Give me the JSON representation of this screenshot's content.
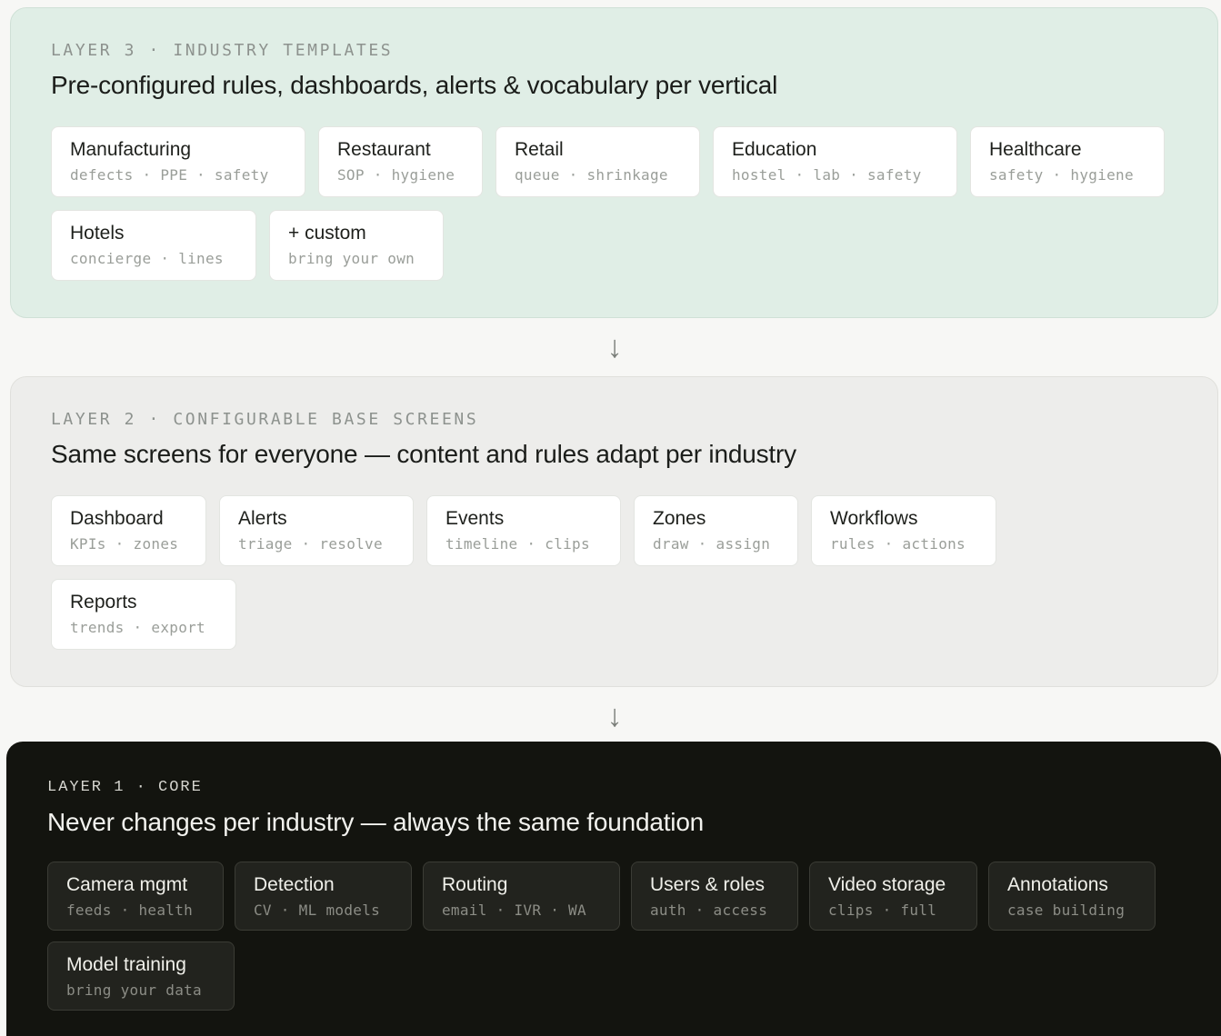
{
  "layer3": {
    "eyebrow": "LAYER 3 · INDUSTRY TEMPLATES",
    "title": "Pre-configured rules, dashboards, alerts & vocabulary per vertical",
    "chips": [
      {
        "title": "Manufacturing",
        "sub": "defects · PPE · safety"
      },
      {
        "title": "Restaurant",
        "sub": "SOP · hygiene"
      },
      {
        "title": "Retail",
        "sub": "queue · shrinkage"
      },
      {
        "title": "Education",
        "sub": "hostel · lab · safety"
      },
      {
        "title": "Healthcare",
        "sub": "safety · hygiene"
      },
      {
        "title": "Hotels",
        "sub": "concierge · lines"
      },
      {
        "title": "+ custom",
        "sub": "bring your own"
      }
    ]
  },
  "arrow": "↓",
  "layer2": {
    "eyebrow": "LAYER 2 · CONFIGURABLE BASE SCREENS",
    "title": "Same screens for everyone — content and rules adapt per industry",
    "chips": [
      {
        "title": "Dashboard",
        "sub": "KPIs · zones"
      },
      {
        "title": "Alerts",
        "sub": "triage · resolve"
      },
      {
        "title": "Events",
        "sub": "timeline · clips"
      },
      {
        "title": "Zones",
        "sub": "draw · assign"
      },
      {
        "title": "Workflows",
        "sub": "rules · actions"
      },
      {
        "title": "Reports",
        "sub": "trends · export"
      }
    ]
  },
  "layer1": {
    "eyebrow": "LAYER 1 · CORE",
    "title": "Never changes per industry — always the same foundation",
    "chips": [
      {
        "title": "Camera mgmt",
        "sub": "feeds · health"
      },
      {
        "title": "Detection",
        "sub": "CV · ML models"
      },
      {
        "title": "Routing",
        "sub": "email · IVR · WA"
      },
      {
        "title": "Users & roles",
        "sub": "auth · access"
      },
      {
        "title": "Video storage",
        "sub": "clips · full"
      },
      {
        "title": "Annotations",
        "sub": "case building"
      },
      {
        "title": "Model training",
        "sub": "bring your data"
      }
    ]
  }
}
